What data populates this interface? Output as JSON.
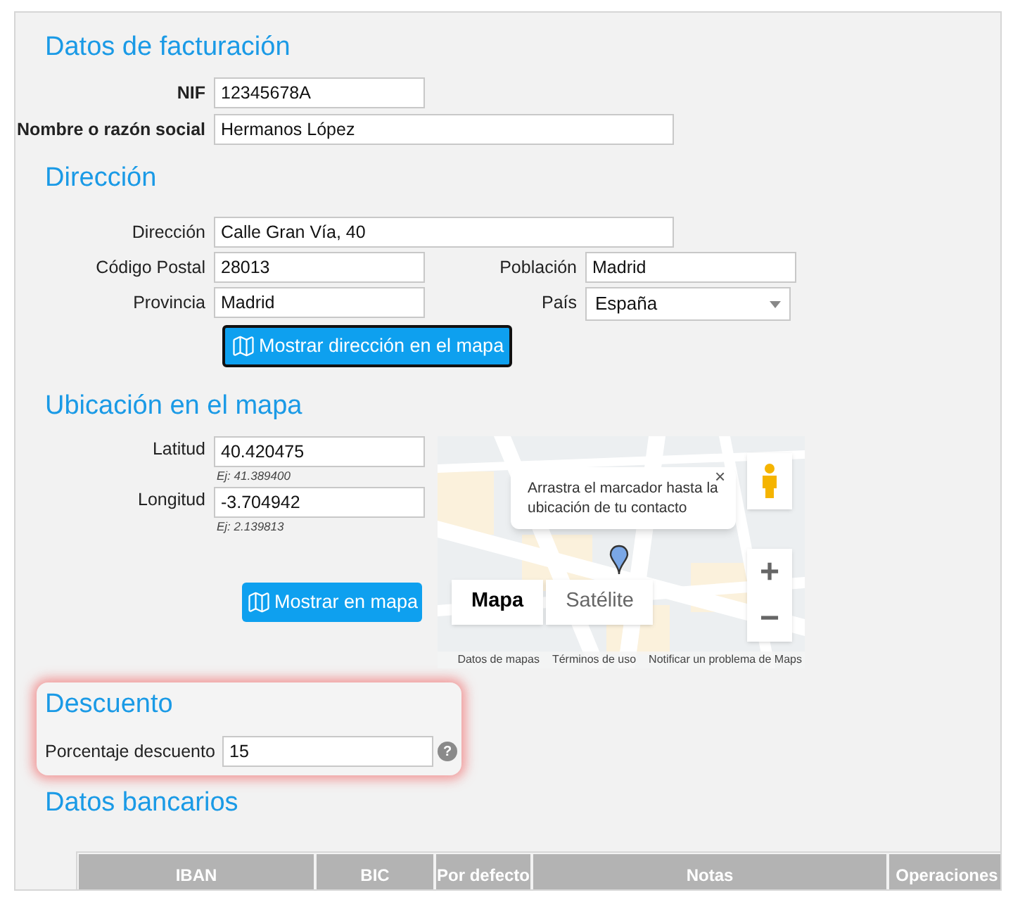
{
  "billing": {
    "title": "Datos de facturación",
    "fields": [
      {
        "label": "NIF",
        "value": "12345678A"
      },
      {
        "label": "Nombre o razón social",
        "value": "Hermanos López"
      }
    ]
  },
  "address": {
    "title": "Dirección",
    "street": {
      "label": "Dirección",
      "value": "Calle Gran Vía, 40"
    },
    "rows": [
      [
        {
          "label": "Código Postal",
          "value": "28013",
          "kind": "input"
        },
        {
          "label": "Población",
          "value": "Madrid",
          "kind": "input"
        }
      ],
      [
        {
          "label": "Provincia",
          "value": "Madrid",
          "kind": "input"
        },
        {
          "label": "País",
          "value": "España",
          "kind": "select"
        }
      ]
    ],
    "button": "Mostrar dirección en el mapa"
  },
  "location": {
    "title": "Ubicación en el mapa",
    "fields": [
      {
        "label": "Latitud",
        "value": "40.420475",
        "hint": "Ej: 41.389400"
      },
      {
        "label": "Longitud",
        "value": "-3.704942",
        "hint": "Ej: 2.139813"
      }
    ],
    "button": "Mostrar en mapa",
    "map": {
      "tooltip": "Arrastra el marcador hasta la ubicación de tu contacto",
      "close": "×",
      "map_types": [
        {
          "label": "Mapa",
          "selected": true
        },
        {
          "label": "Satélite",
          "selected": false
        }
      ],
      "zoom": [
        "+",
        "−"
      ],
      "footer": [
        "Datos de mapas",
        "Términos de uso",
        "Notificar un problema de Maps"
      ]
    }
  },
  "discount": {
    "title": "Descuento",
    "label": "Porcentaje descuento",
    "value": "15",
    "help": "?"
  },
  "bank": {
    "title": "Datos bancarios",
    "columns": [
      "IBAN",
      "BIC",
      "Por defecto",
      "Notas",
      "Operaciones"
    ]
  }
}
